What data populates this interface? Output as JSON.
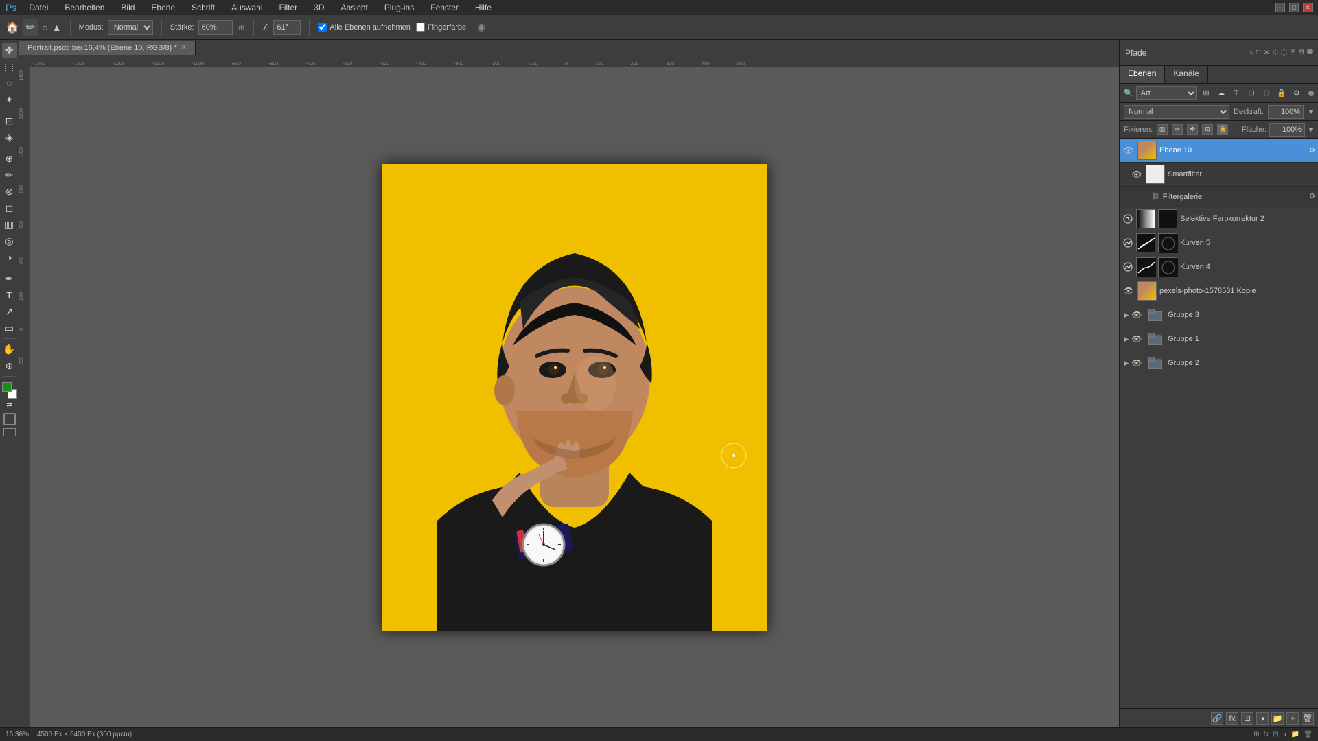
{
  "app": {
    "title": "Adobe Photoshop",
    "window_controls": [
      "minimize",
      "maximize",
      "close"
    ]
  },
  "titlebar": {
    "file_name": "Portrait.psdc bei 16,4% (Ebene 10, RGB/8)",
    "modified": true
  },
  "menubar": {
    "items": [
      "Datei",
      "Bearbeiten",
      "Bild",
      "Ebene",
      "Schrift",
      "Auswahl",
      "Filter",
      "3D",
      "Ansicht",
      "Plug-ins",
      "Fenster",
      "Hilfe"
    ]
  },
  "toolbar": {
    "mode_label": "Modus:",
    "mode_value": "Normal",
    "strength_label": "Stärke:",
    "strength_value": "60%",
    "angle_value": "61°",
    "sample_all_label": "Alle Ebenen aufnehmen",
    "sample_all_checked": true,
    "fingercolor_label": "Fingerfarbe",
    "fingercolor_checked": false
  },
  "canvas": {
    "tab_label": "Portrait.psdc bei 16,4% (Ebene 10, RGB/8) *",
    "zoom": "16,36%",
    "dimensions": "4500 Px × 5400 Px (300 ppcm)"
  },
  "panels": {
    "paths": {
      "title": "Pfade"
    },
    "layers": {
      "tab_label": "Ebenen",
      "channels_tab": "Kanäle",
      "blend_mode": "Normal",
      "opacity_label": "Deckraft:",
      "opacity_value": "100%",
      "lock_label": "Fixieren:",
      "fill_label": "Fläche:",
      "fill_value": "100%",
      "search_placeholder": "Art",
      "layers": [
        {
          "id": "ebene10",
          "name": "Ebene 10",
          "type": "layer",
          "visible": true,
          "active": true,
          "expanded": true,
          "thumb_type": "photo",
          "sub_items": [
            {
              "id": "smartfilter",
              "name": "Smartfilter",
              "type": "smartfilter",
              "visible": true,
              "thumb_type": "white"
            },
            {
              "id": "filtergalerie",
              "name": "Filtergalerie",
              "type": "filter",
              "visible": true,
              "thumb_type": "none",
              "indent": 2
            }
          ]
        },
        {
          "id": "selective-color2",
          "name": "Selektive Farbkorrektur 2",
          "type": "adjustment",
          "visible": true,
          "active": false,
          "thumb_type": "adj-selective"
        },
        {
          "id": "curves5",
          "name": "Kurven 5",
          "type": "adjustment",
          "visible": true,
          "active": false,
          "thumb_type": "adj-curves"
        },
        {
          "id": "curves4",
          "name": "Kurven 4",
          "type": "adjustment",
          "visible": true,
          "active": false,
          "thumb_type": "adj-curves"
        },
        {
          "id": "photo-copy",
          "name": "pexels-photo-1578531 Kopie",
          "type": "layer",
          "visible": true,
          "active": false,
          "thumb_type": "photo"
        },
        {
          "id": "group3",
          "name": "Gruppe 3",
          "type": "group",
          "visible": true,
          "active": false
        },
        {
          "id": "group1",
          "name": "Gruppe 1",
          "type": "group",
          "visible": true,
          "active": false
        },
        {
          "id": "group2",
          "name": "Gruppe 2",
          "type": "group",
          "visible": true,
          "active": false
        }
      ]
    }
  },
  "statusbar": {
    "zoom": "16,36%",
    "dimensions": "4500 Px × 5400 Px (300 ppcm)"
  },
  "toolbox": {
    "tools": [
      {
        "id": "move",
        "icon": "✥",
        "label": "move-tool"
      },
      {
        "id": "select-rect",
        "icon": "⬚",
        "label": "rectangular-select-tool"
      },
      {
        "id": "lasso",
        "icon": "◌",
        "label": "lasso-tool"
      },
      {
        "id": "magic-wand",
        "icon": "✦",
        "label": "magic-wand-tool"
      },
      {
        "id": "crop",
        "icon": "⊡",
        "label": "crop-tool"
      },
      {
        "id": "eyedropper",
        "icon": "⌖",
        "label": "eyedropper-tool"
      },
      {
        "id": "healing",
        "icon": "⊕",
        "label": "healing-brush-tool"
      },
      {
        "id": "brush",
        "icon": "✏",
        "label": "brush-tool"
      },
      {
        "id": "stamp",
        "icon": "⊗",
        "label": "stamp-tool"
      },
      {
        "id": "eraser",
        "icon": "◻",
        "label": "eraser-tool"
      },
      {
        "id": "gradient",
        "icon": "▥",
        "label": "gradient-tool"
      },
      {
        "id": "blur",
        "icon": "◎",
        "label": "blur-tool"
      },
      {
        "id": "dodge",
        "icon": "◑",
        "label": "dodge-tool"
      },
      {
        "id": "pen",
        "icon": "✒",
        "label": "pen-tool"
      },
      {
        "id": "text",
        "icon": "T",
        "label": "text-tool"
      },
      {
        "id": "path-select",
        "icon": "↗",
        "label": "path-selection-tool"
      },
      {
        "id": "shape",
        "icon": "▭",
        "label": "shape-tool"
      },
      {
        "id": "hand",
        "icon": "✋",
        "label": "hand-tool"
      },
      {
        "id": "zoom",
        "icon": "⊕",
        "label": "zoom-tool"
      }
    ]
  }
}
